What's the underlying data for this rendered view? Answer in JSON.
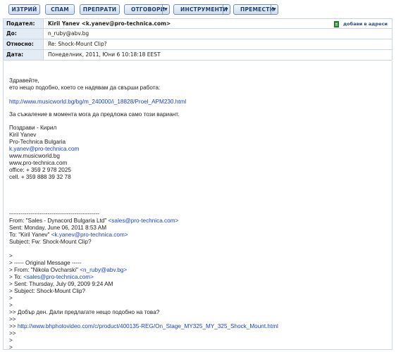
{
  "toolbar": {
    "delete": "ИЗТРИЙ",
    "spam": "СПАМ",
    "forward": "ПРЕПРАТИ",
    "reply": "ОТГОВОРИ",
    "tools": "ИНСТРУМЕНТИ",
    "move": "ПРЕМЕСТИ",
    "caret": "▼"
  },
  "header": {
    "from_label": "Подател:",
    "from_value": "Kiril Yanev <k.yanev@pro-technica.com>",
    "add_to_contacts": "добави в адреси",
    "to_label": "До:",
    "to_value": "n_ruby@abv.bg",
    "subject_label": "Относно:",
    "subject_value": "Re: Shock-Mount Clip?",
    "date_label": "Дата:",
    "date_value": "Понеделник, 2011, Юни 6 10:18:18 EEST"
  },
  "body": {
    "greeting": "Здравейте,",
    "intro": "ето нещо подобно, което се надявам да свърши работа:",
    "link1": "http://www.musicworld.bg/bg/m_240000/i_18828/Proel_APM230.html",
    "note": "За съжаление в момента мога да предложа само този вариант.",
    "sig_greeting": "Поздрави - Кирил",
    "sig_name": "Kiril Yanev",
    "sig_company": "Pro-Technica Bulgaria",
    "sig_email": "k.yanev@pro-technica.com",
    "sig_web1": "www.musicworld.bg",
    "sig_web2": "www.pro-technica.com",
    "sig_office": "office: + 359 2 978 2025",
    "sig_cell": "cell. + 359 888 39 32 78",
    "separator": "-----------------------------------------------",
    "q_from_prefix": "From: \"Sales - Dynacord Bulgaria Ltd\" ",
    "q_from_link": "<sales@pro-technica.com>",
    "q_sent": "Sent: Monday, June 06, 2011 8:53 AM",
    "q_to_prefix": "To: \"Kiril Yanev\" ",
    "q_to_link": "<k.yanev@pro-technica.com>",
    "q_subject": "Subject: Fw: Shock-Mount Clip?",
    "q1": ">",
    "q_orig": "> ----- Original Message -----",
    "q_from2_prefix": "> From: \"Nikola Ovcharski\" ",
    "q_from2_link": "<n_ruby@abv.bg>",
    "q_to2_prefix": "> To: ",
    "q_to2_link": "<sales@pro-technica.com>",
    "q_sent2": "> Sent: Thursday, July 09, 2009 9:24 AM",
    "q_subject2": "> Subject: Shock-Mount Clip?",
    "q2": ">",
    "q3": ">",
    "q_question": ">> Добър ден. Дали предлагате нещо подобно на това?",
    "q4": ">>",
    "q_link_prefix": ">> ",
    "q_link": "http://www.bhphotovideo.com/c/product/400135-REG/On_Stage_MY325_MY_325_Shock_Mount.html",
    "q5": ">>",
    "q6": ">",
    "q7": ">"
  }
}
